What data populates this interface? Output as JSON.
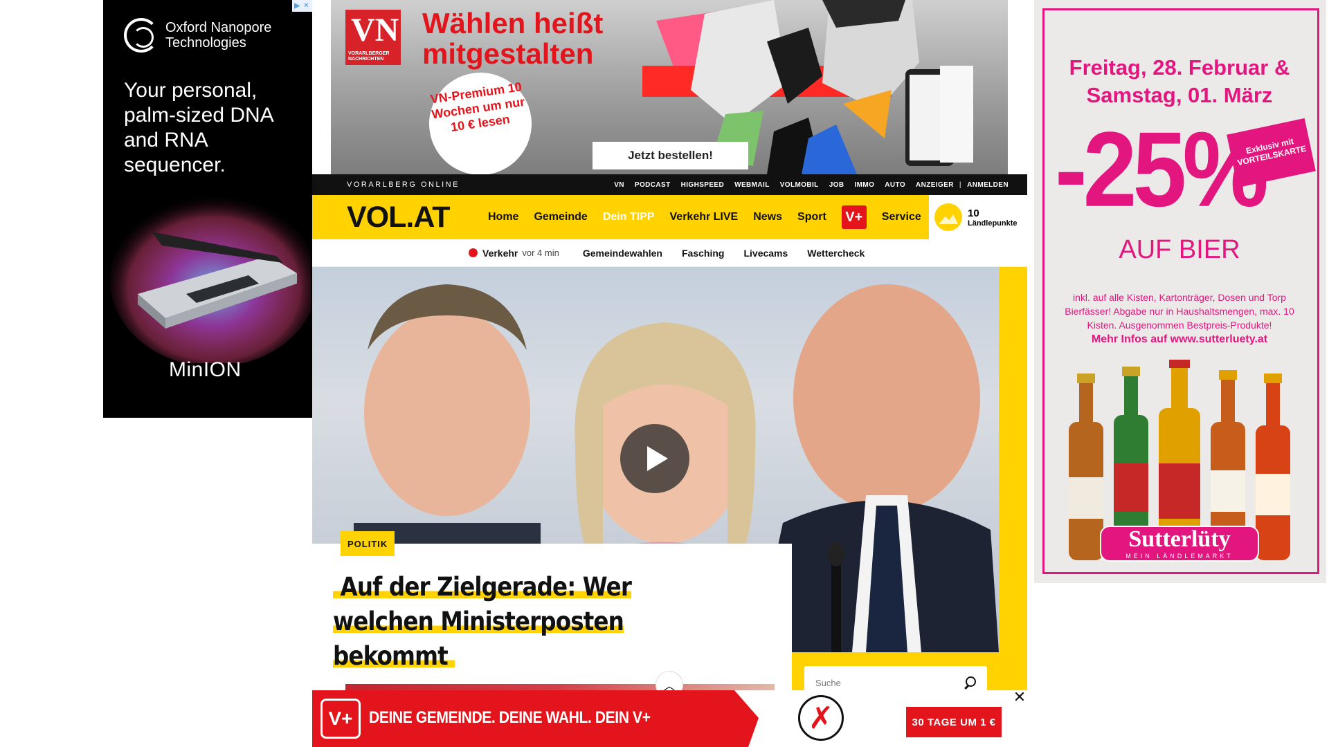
{
  "ads": {
    "left": {
      "brand": "Oxford Nanopore Technologies",
      "tagline": "Your personal, palm-sized DNA and RNA sequencer.",
      "product": "MinION"
    },
    "top": {
      "logo_text": "VN",
      "logo_sub": "VORARLBERGER NACHRICHTEN",
      "headline": "Wählen heißt mitgestalten",
      "offer": "VN-Premium 10 Wochen um nur 10 € lesen",
      "cta": "Jetzt bestellen!"
    },
    "right": {
      "dates": "Freitag, 28. Februar & Samstag, 01. März",
      "discount": "-25%",
      "stamp": "Exklusiv mit VORTEILSKARTE",
      "product": "AUF BIER",
      "fine_print": "inkl. auf alle Kisten, Kartonträger, Dosen und Torp Bierfässer! Abgabe nur in Haushaltsmengen, max. 10 Kisten. Ausgenommen Bestpreis-Produkte!",
      "more_info": "Mehr Infos auf www.sutterluety.at",
      "brand": "Sutterlüty",
      "brand_sub": "MEIN LÄNDLEMARKT"
    },
    "bottom": {
      "logo": "V+",
      "slogan": "DEINE GEMEINDE. DEINE WAHL. DEIN V+",
      "cta": "30 TAGE UM 1 €",
      "close": "✕"
    }
  },
  "site": {
    "topbar": {
      "brand": "VORARLBERG ONLINE",
      "links": [
        "VN",
        "PODCAST",
        "HIGHSPEED",
        "WEBMAIL",
        "VOLMOBIL",
        "JOB",
        "IMMO",
        "AUTO",
        "ANZEIGER"
      ],
      "separator": "|",
      "login": "ANMELDEN"
    },
    "logo": "VOL.AT",
    "nav": [
      "Home",
      "Gemeinde",
      "Dein TIPP",
      "Verkehr LIVE",
      "News",
      "Sport"
    ],
    "nav_vplus": "V+",
    "nav_service": "Service",
    "points": {
      "value": "10",
      "label": "Ländlepunkte"
    },
    "subnav": {
      "live_label": "Verkehr",
      "live_time": "vor 4 min",
      "items": [
        "Gemeindewahlen",
        "Fasching",
        "Livecams",
        "Wettercheck"
      ]
    },
    "hero": {
      "category": "POLITIK",
      "title": "Auf der Zielgerade: Wer welchen Ministerposten bekommt"
    },
    "search": {
      "placeholder": "Suche"
    }
  }
}
